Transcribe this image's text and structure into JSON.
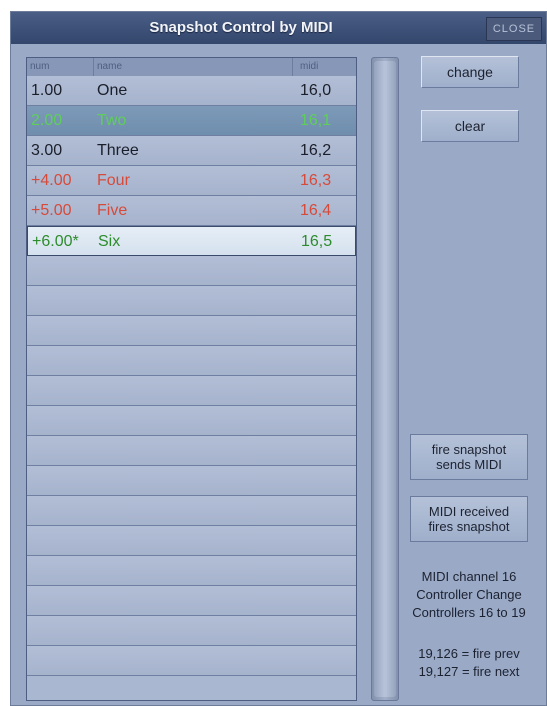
{
  "window": {
    "title": "Snapshot Control by MIDI",
    "close_label": "CLOSE"
  },
  "table": {
    "headers": {
      "num": "num",
      "name": "name",
      "midi": "midi"
    },
    "rows": [
      {
        "num": "1.00",
        "name": "One",
        "midi": "16,0",
        "color": "#1b1f2b",
        "style": "normal"
      },
      {
        "num": "2.00",
        "name": "Two",
        "midi": "16,1",
        "color": "#5fce5c",
        "style": "sel-green"
      },
      {
        "num": "3.00",
        "name": "Three",
        "midi": "16,2",
        "color": "#1b1f2b",
        "style": "normal"
      },
      {
        "num": "+4.00",
        "name": "Four",
        "midi": "16,3",
        "color": "#d64a3a",
        "style": "normal"
      },
      {
        "num": "+5.00",
        "name": "Five",
        "midi": "16,4",
        "color": "#d64a3a",
        "style": "normal"
      },
      {
        "num": "+6.00*",
        "name": "Six",
        "midi": "16,5",
        "color": "#2c8c2c",
        "style": "sel-light"
      }
    ],
    "empty_rows": 14
  },
  "buttons": {
    "change": "change",
    "clear": "clear",
    "fire_line1": "fire snapshot",
    "fire_line2": "sends MIDI",
    "midi_line1": "MIDI received",
    "midi_line2": "fires snapshot"
  },
  "info": {
    "line1": "MIDI channel 16",
    "line2": "Controller Change",
    "line3": "Controllers 16 to 19",
    "line4": "19,126 = fire prev",
    "line5": "19,127 = fire next"
  }
}
